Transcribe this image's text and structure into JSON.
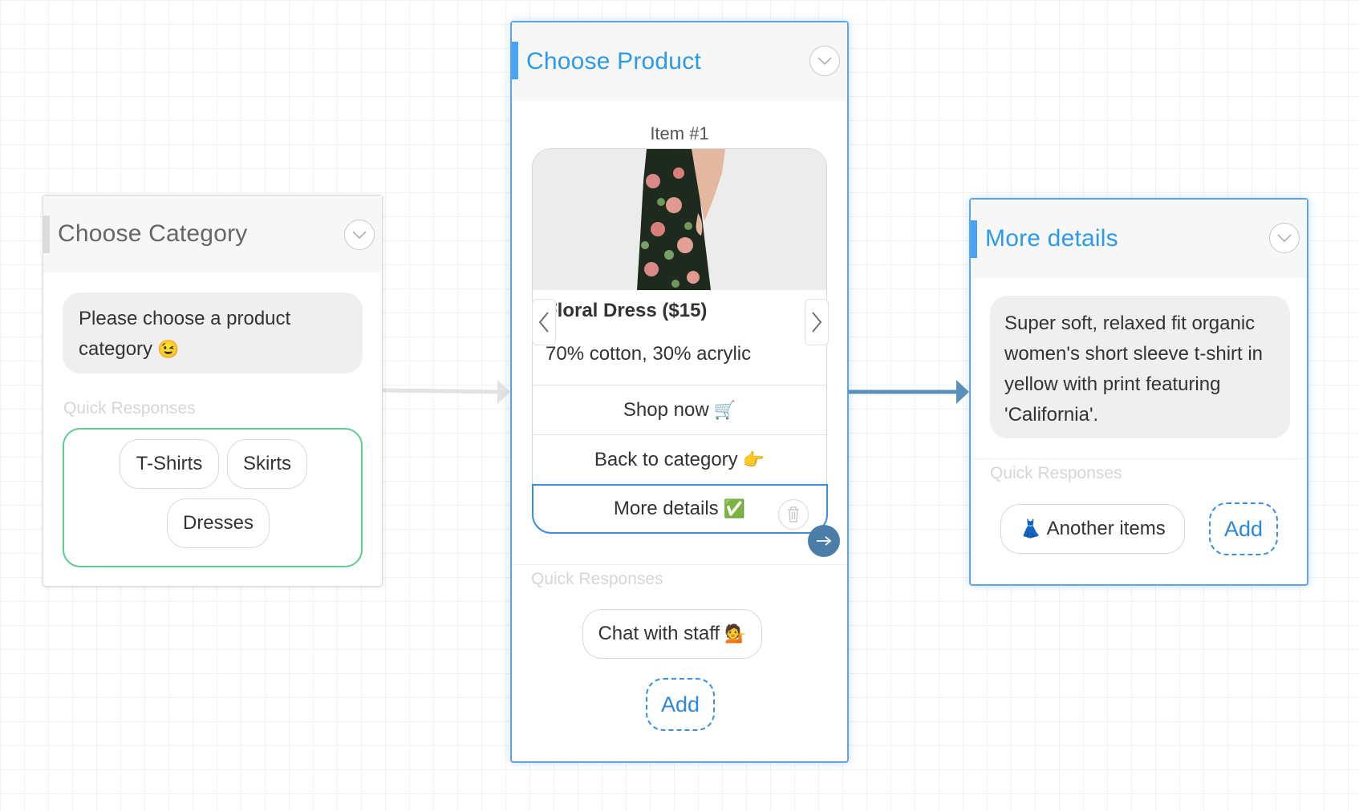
{
  "colors": {
    "accent": "#2d9ae8",
    "connector_active": "#5a8fb8",
    "connector_inactive": "#e2e2e2",
    "quick_response_group_border": "#5ccc94"
  },
  "category_node": {
    "title": "Choose Category",
    "message": "Please choose a product category",
    "message_emoji": "😉",
    "quick_responses_label": "Quick Responses",
    "options": [
      "T-Shirts",
      "Skirts",
      "Dresses"
    ]
  },
  "product_node": {
    "title": "Choose Product",
    "item_label": "Item #1",
    "item_title": "Floral Dress ($15)",
    "item_subtitle": "70% cotton, 30% acrylic",
    "buttons": {
      "shop_now": "Shop now",
      "shop_now_emoji": "🛒",
      "back": "Back to category",
      "back_emoji": "👉",
      "more": "More details",
      "more_emoji": "✅"
    },
    "quick_responses_label": "Quick Responses",
    "quick_response": "Chat with staff",
    "quick_response_emoji": "💁",
    "add_label": "Add"
  },
  "details_node": {
    "title": "More details",
    "message": "Super soft, relaxed fit organic women's short sleeve t-shirt in yellow with print featuring 'California'.",
    "quick_responses_label": "Quick Responses",
    "quick_response": "Another items",
    "quick_response_emoji": "👗",
    "add_label": "Add"
  }
}
